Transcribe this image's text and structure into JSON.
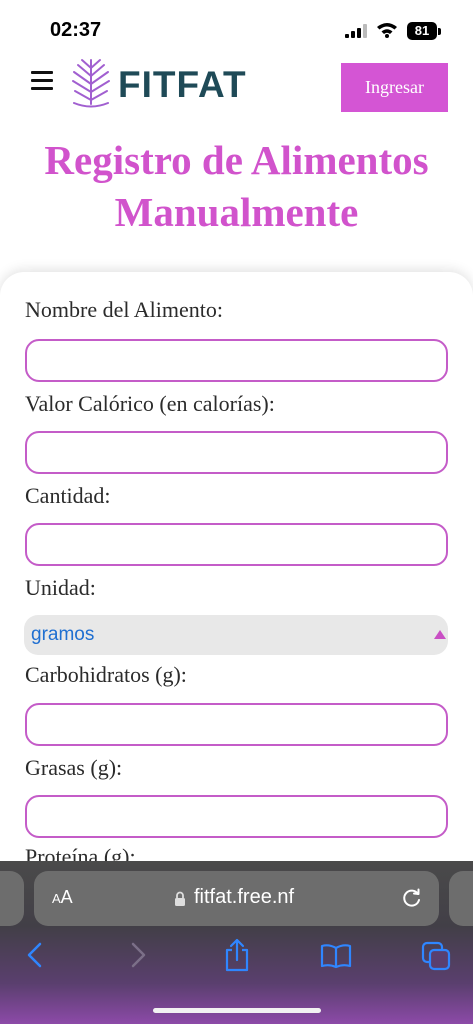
{
  "status_bar": {
    "time": "02:37",
    "battery": "81",
    "icons": [
      "signal-icon",
      "wifi-icon",
      "battery-icon"
    ]
  },
  "header": {
    "logo_text": "FITFAT",
    "login_label": "Ingresar",
    "icons": [
      "menu-icon",
      "leaf-logo-icon"
    ]
  },
  "page": {
    "title_line1": "Registro de Alimentos",
    "title_line2": "Manualmente"
  },
  "form": {
    "food_name_label": "Nombre del Alimento:",
    "food_name_value": "",
    "calories_label": "Valor Calórico (en calorías):",
    "calories_value": "",
    "quantity_label": "Cantidad:",
    "quantity_value": "",
    "unit_label": "Unidad:",
    "unit_value": "gramos",
    "carbs_label": "Carbohidratos (g):",
    "carbs_value": "",
    "fats_label": "Grasas (g):",
    "fats_value": "",
    "protein_label": "Proteína (g):"
  },
  "browser": {
    "text_size_small": "A",
    "text_size_big": "A",
    "url": "fitfat.free.nf",
    "icons": [
      "lock-icon",
      "reload-icon",
      "back-icon",
      "forward-icon",
      "share-icon",
      "bookmarks-icon",
      "tabs-icon"
    ]
  },
  "colors": {
    "accent": "#d455d4",
    "title": "#d153cc",
    "logo_text": "#1f4a57",
    "input_border": "#c45cc8",
    "link_blue": "#1f6fd1"
  }
}
